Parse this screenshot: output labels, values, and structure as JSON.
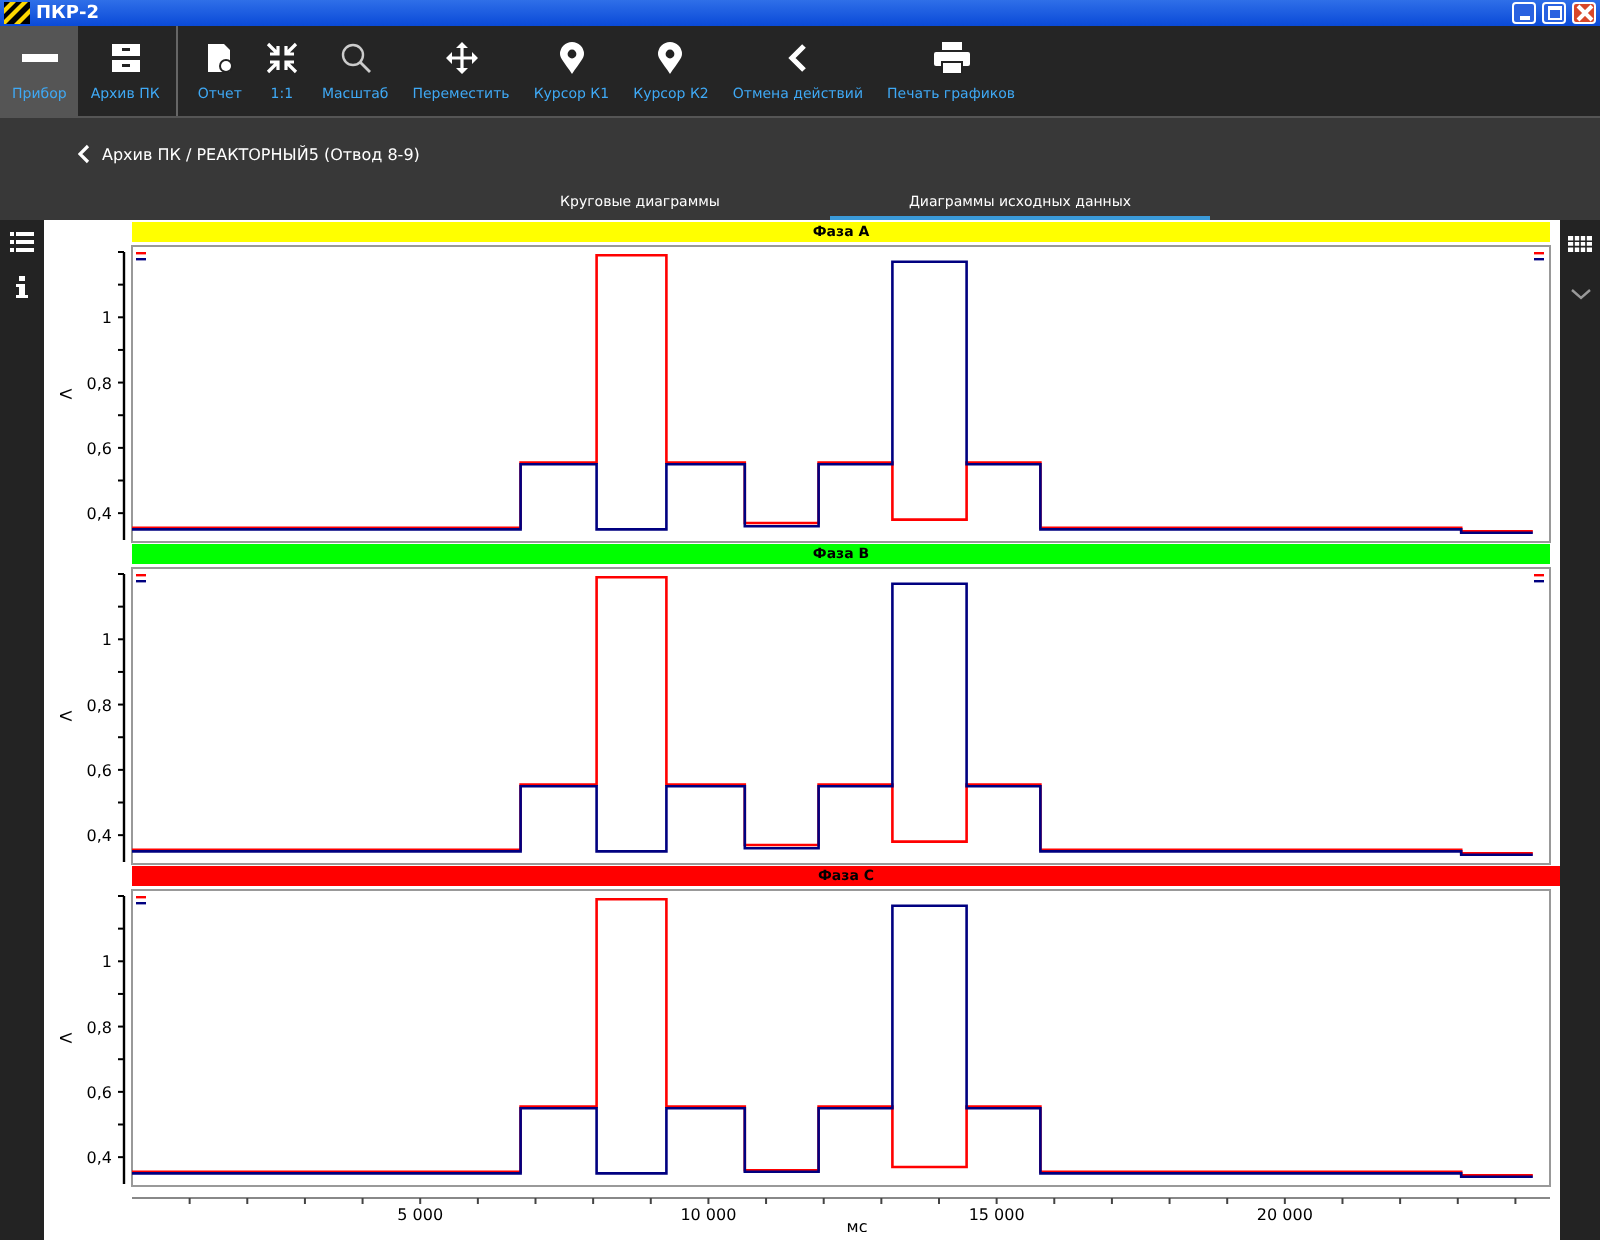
{
  "window": {
    "title": "ПКР-2"
  },
  "toolbar": {
    "left": [
      {
        "label": "Прибор",
        "kind": "device",
        "selected": true
      },
      {
        "label": "Архив ПК",
        "kind": "archive",
        "selected": false
      }
    ],
    "right": [
      {
        "label": "Отчет",
        "kind": "report"
      },
      {
        "label": "1:1",
        "kind": "fit"
      },
      {
        "label": "Масштаб",
        "kind": "zoom"
      },
      {
        "label": "Переместить",
        "kind": "move"
      },
      {
        "label": "Курсор К1",
        "kind": "pin"
      },
      {
        "label": "Курсор К2",
        "kind": "pin"
      },
      {
        "label": "Отмена действий",
        "kind": "undo"
      },
      {
        "label": "Печать графиков",
        "kind": "print"
      }
    ]
  },
  "breadcrumb": "Архив ПК / РЕАКТОРНЫЙ5 (Отвод 8-9)",
  "tabs": [
    {
      "label": "Круговые диаграммы",
      "selected": false
    },
    {
      "label": "Диаграммы исходных данных",
      "selected": true
    }
  ],
  "panels": [
    {
      "title": "Фаза А",
      "color": "#ffff00",
      "legend_right": true,
      "chart_data": {
        "type": "line",
        "ylabel": "V",
        "xlim": [
          0,
          24600
        ],
        "ylim": [
          0.33,
          1.2
        ],
        "yticks": [
          {
            "value": 0.4,
            "label": "0,4"
          },
          {
            "value": 0.6,
            "label": "0,6"
          },
          {
            "value": 0.8,
            "label": "0,8"
          },
          {
            "value": 1,
            "label": "1"
          }
        ],
        "x": [
          0,
          6740,
          6740,
          8060,
          8060,
          9270,
          9270,
          10630,
          10630,
          11910,
          11910,
          13190,
          13190,
          14480,
          14480,
          15760,
          15760,
          23060,
          23060,
          24300
        ],
        "series": [
          {
            "color": "#ff0000",
            "values": [
              0.355,
              0.355,
              0.555,
              0.555,
              1.19,
              1.19,
              0.555,
              0.555,
              0.37,
              0.37,
              0.555,
              0.555,
              0.38,
              0.38,
              0.555,
              0.555,
              0.355,
              0.355,
              0.345,
              0.345
            ]
          },
          {
            "color": "#000080",
            "values": [
              0.35,
              0.35,
              0.55,
              0.55,
              0.35,
              0.35,
              0.55,
              0.55,
              0.36,
              0.36,
              0.55,
              0.55,
              1.17,
              1.17,
              0.55,
              0.55,
              0.35,
              0.35,
              0.34,
              0.34
            ]
          }
        ]
      }
    },
    {
      "title": "Фаза В",
      "color": "#00ff00",
      "legend_right": true,
      "chart_data": {
        "type": "line",
        "ylabel": "V",
        "xlim": [
          0,
          24600
        ],
        "ylim": [
          0.33,
          1.2
        ],
        "yticks": [
          {
            "value": 0.4,
            "label": "0,4"
          },
          {
            "value": 0.6,
            "label": "0,6"
          },
          {
            "value": 0.8,
            "label": "0,8"
          },
          {
            "value": 1,
            "label": "1"
          }
        ],
        "x": [
          0,
          6740,
          6740,
          8060,
          8060,
          9270,
          9270,
          10630,
          10630,
          11910,
          11910,
          13190,
          13190,
          14480,
          14480,
          15760,
          15760,
          23060,
          23060,
          24300
        ],
        "series": [
          {
            "color": "#ff0000",
            "values": [
              0.355,
              0.355,
              0.555,
              0.555,
              1.19,
              1.19,
              0.555,
              0.555,
              0.37,
              0.37,
              0.555,
              0.555,
              0.38,
              0.38,
              0.555,
              0.555,
              0.355,
              0.355,
              0.345,
              0.345
            ]
          },
          {
            "color": "#000080",
            "values": [
              0.35,
              0.35,
              0.55,
              0.55,
              0.35,
              0.35,
              0.55,
              0.55,
              0.36,
              0.36,
              0.55,
              0.55,
              1.17,
              1.17,
              0.55,
              0.55,
              0.35,
              0.35,
              0.34,
              0.34
            ]
          }
        ]
      }
    },
    {
      "title": "Фаза С",
      "color": "#ff0000",
      "legend_right": false,
      "chart_data": {
        "type": "line",
        "xlabel": "мс",
        "ylabel": "V",
        "xlim": [
          0,
          24600
        ],
        "ylim": [
          0.33,
          1.2
        ],
        "xticks": [
          {
            "value": 5000,
            "label": "5 000"
          },
          {
            "value": 10000,
            "label": "10 000"
          },
          {
            "value": 15000,
            "label": "15 000"
          },
          {
            "value": 20000,
            "label": "20 000"
          }
        ],
        "yticks": [
          {
            "value": 0.4,
            "label": "0,4"
          },
          {
            "value": 0.6,
            "label": "0,6"
          },
          {
            "value": 0.8,
            "label": "0,8"
          },
          {
            "value": 1,
            "label": "1"
          }
        ],
        "x": [
          0,
          6740,
          6740,
          8060,
          8060,
          9270,
          9270,
          10630,
          10630,
          11910,
          11910,
          13190,
          13190,
          14480,
          14480,
          15760,
          15760,
          23060,
          23060,
          24300
        ],
        "series": [
          {
            "color": "#ff0000",
            "values": [
              0.355,
              0.355,
              0.555,
              0.555,
              1.19,
              1.19,
              0.555,
              0.555,
              0.36,
              0.36,
              0.555,
              0.555,
              0.37,
              0.37,
              0.555,
              0.555,
              0.355,
              0.355,
              0.345,
              0.345
            ]
          },
          {
            "color": "#000080",
            "values": [
              0.35,
              0.35,
              0.55,
              0.55,
              0.35,
              0.35,
              0.55,
              0.55,
              0.355,
              0.355,
              0.55,
              0.55,
              1.17,
              1.17,
              0.55,
              0.55,
              0.35,
              0.35,
              0.34,
              0.34
            ]
          }
        ]
      }
    }
  ]
}
